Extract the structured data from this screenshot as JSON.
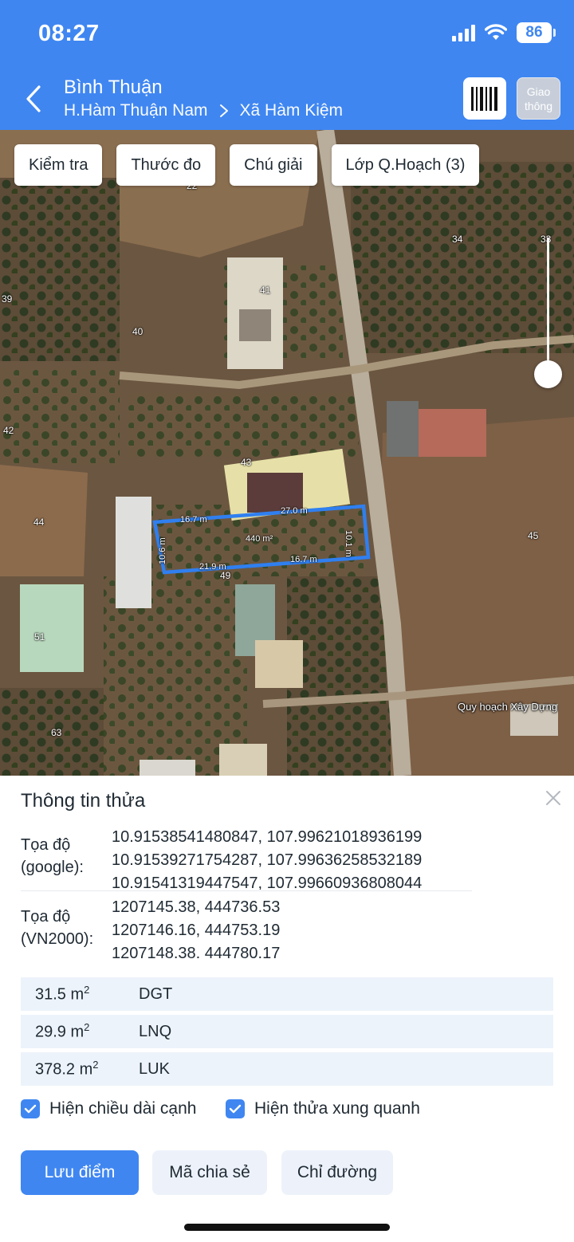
{
  "status_bar": {
    "time": "08:27",
    "battery": "86"
  },
  "nav": {
    "title": "Bình Thuận",
    "district": "H.Hàm Thuận Nam",
    "commune": "Xã Hàm Kiệm",
    "traffic_button": "Giao thông"
  },
  "map_toolbar": {
    "check": "Kiểm tra",
    "measure": "Thước đo",
    "legend": "Chú giải",
    "planning_layer": "Lớp Q.Hoạch (3)"
  },
  "map": {
    "parcel_numbers": [
      "22",
      "34",
      "33",
      "39",
      "41",
      "40",
      "42",
      "43",
      "44",
      "45",
      "49",
      "51",
      "63"
    ],
    "selected_parcel": {
      "edge_lengths": [
        "16.7 m",
        "27.0 m",
        "10.1 m",
        "16.7 m",
        "21.9 m",
        "10.6 m"
      ],
      "area": "440 m²",
      "outline_color": "#2f7ff0"
    },
    "planning_label": "Quy hoạch Xây Dựng"
  },
  "panel": {
    "title": "Thông tin thửa",
    "google_label_line1": "Tọa độ",
    "google_label_line2": "(google):",
    "google_coords": [
      "10.91538541480847, 107.99621018936199",
      "10.91539271754287, 107.99636258532189",
      "10.91541319447547, 107.99660936808044"
    ],
    "vn2000_label_line1": "Tọa độ",
    "vn2000_label_line2": "(VN2000):",
    "vn2000_coords": [
      "1207145.38, 444736.53",
      "1207146.16, 444753.19",
      "1207148.38, 444780.17"
    ],
    "land_use": [
      {
        "area": "31.5 m",
        "code": "DGT"
      },
      {
        "area": "29.9 m",
        "code": "LNQ"
      },
      {
        "area": "378.2 m",
        "code": "LUK"
      }
    ],
    "area_unit_superscript": "2",
    "checkbox_edge_lengths": "Hiện chiều dài cạnh",
    "checkbox_neighbors": "Hiện thửa xung quanh",
    "save_point": "Lưu điểm",
    "share_code": "Mã chia sẻ",
    "directions": "Chỉ đường"
  },
  "colors": {
    "accent": "#3f86f1",
    "row_bg": "#edf3fb"
  }
}
